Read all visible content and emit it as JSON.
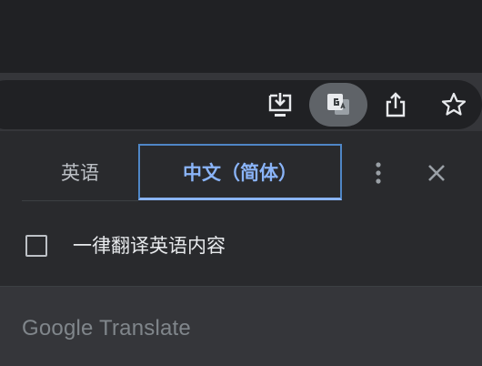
{
  "toolbar": {
    "icons": [
      "install-app-icon",
      "translate-icon",
      "share-icon",
      "bookmark-star-icon"
    ]
  },
  "translate_bubble": {
    "source_language": "英语",
    "target_language": "中文（简体）",
    "always_translate_label": "一律翻译英语内容",
    "always_translate_checked": false,
    "branding": "Google Translate"
  },
  "colors": {
    "accent": "#8ab4f8",
    "panel_bg": "#292a2d",
    "toolbar_bg": "#35363a",
    "translate_chip_bg": "#5f6368"
  }
}
